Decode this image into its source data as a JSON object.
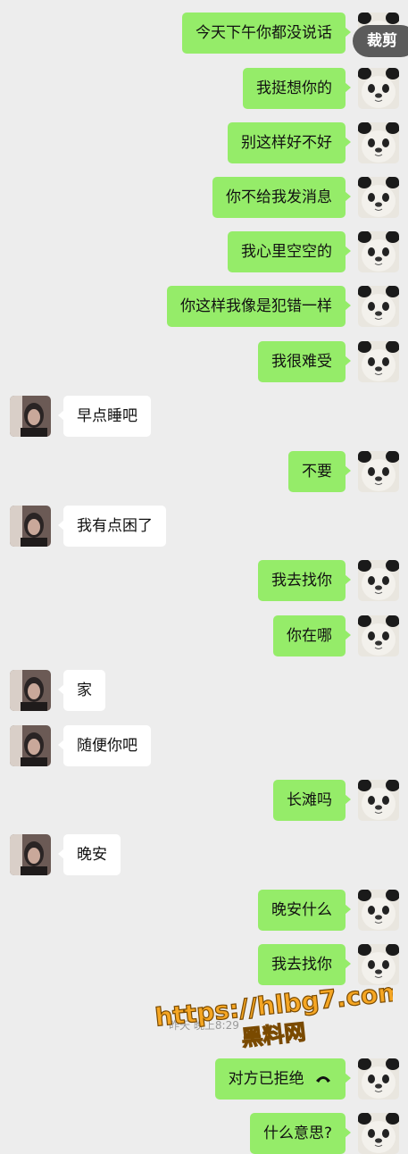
{
  "toolbar": {
    "crop_label": "裁剪"
  },
  "messages": [
    {
      "from": "me",
      "text": "今天下午你都没说话"
    },
    {
      "from": "me",
      "text": "我挺想你的"
    },
    {
      "from": "me",
      "text": "别这样好不好"
    },
    {
      "from": "me",
      "text": "你不给我发消息"
    },
    {
      "from": "me",
      "text": "我心里空空的"
    },
    {
      "from": "me",
      "text": "你这样我像是犯错一样"
    },
    {
      "from": "me",
      "text": "我很难受"
    },
    {
      "from": "them",
      "text": "早点睡吧"
    },
    {
      "from": "me",
      "text": "不要"
    },
    {
      "from": "them",
      "text": "我有点困了"
    },
    {
      "from": "me",
      "text": "我去找你"
    },
    {
      "from": "me",
      "text": "你在哪"
    },
    {
      "from": "them",
      "text": "家"
    },
    {
      "from": "them",
      "text": "随便你吧"
    },
    {
      "from": "me",
      "text": "长滩吗"
    },
    {
      "from": "them",
      "text": "晚安"
    },
    {
      "from": "me",
      "text": "晚安什么"
    },
    {
      "from": "me",
      "text": "我去找你"
    },
    {
      "from": "me",
      "text": "对方已拒绝",
      "icon": "declined-call-icon"
    },
    {
      "from": "me",
      "text": "什么意思?"
    }
  ],
  "timestamp": "昨天 晚上8:29",
  "watermark": {
    "url": "https://hlbg7.com",
    "name": "黑料网"
  },
  "colors": {
    "background": "#ededed",
    "my_bubble": "#95ec69",
    "their_bubble": "#ffffff",
    "watermark": "#f5a623"
  }
}
